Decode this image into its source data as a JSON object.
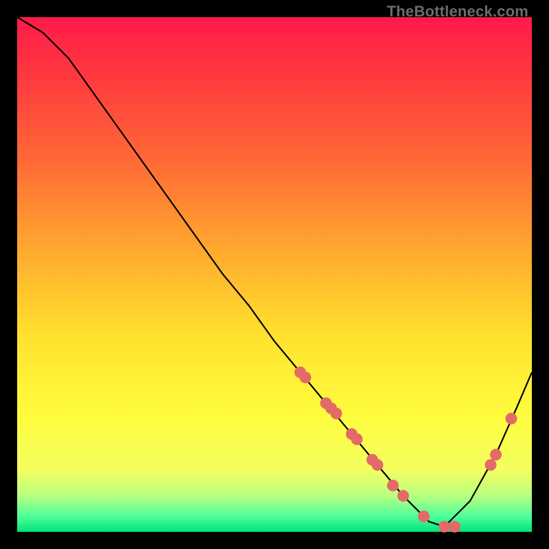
{
  "watermark": "TheBottleneck.com",
  "colors": {
    "dot": "#e46a67",
    "curve": "#000000",
    "background_black": "#000000"
  },
  "chart_data": {
    "type": "line",
    "title": "",
    "xlabel": "",
    "ylabel": "",
    "xlim": [
      0,
      100
    ],
    "ylim": [
      0,
      100
    ],
    "curve": {
      "name": "bottleneck-curve",
      "x": [
        0,
        5,
        10,
        15,
        20,
        25,
        30,
        35,
        40,
        45,
        50,
        55,
        60,
        65,
        70,
        75,
        80,
        83,
        88,
        93,
        97,
        100
      ],
      "y": [
        100,
        97,
        92,
        85,
        78,
        71,
        64,
        57,
        50,
        44,
        37,
        31,
        25,
        19,
        13,
        7,
        2,
        1,
        6,
        15,
        24,
        31
      ]
    },
    "series": [
      {
        "name": "highlighted-points",
        "x": [
          55,
          56,
          60,
          61,
          62,
          65,
          66,
          69,
          70,
          73,
          75,
          79,
          83,
          85,
          92,
          93,
          96
        ],
        "y": [
          31,
          30,
          25,
          24,
          23,
          19,
          18,
          14,
          13,
          9,
          7,
          3,
          1,
          1,
          13,
          15,
          22
        ]
      }
    ]
  }
}
